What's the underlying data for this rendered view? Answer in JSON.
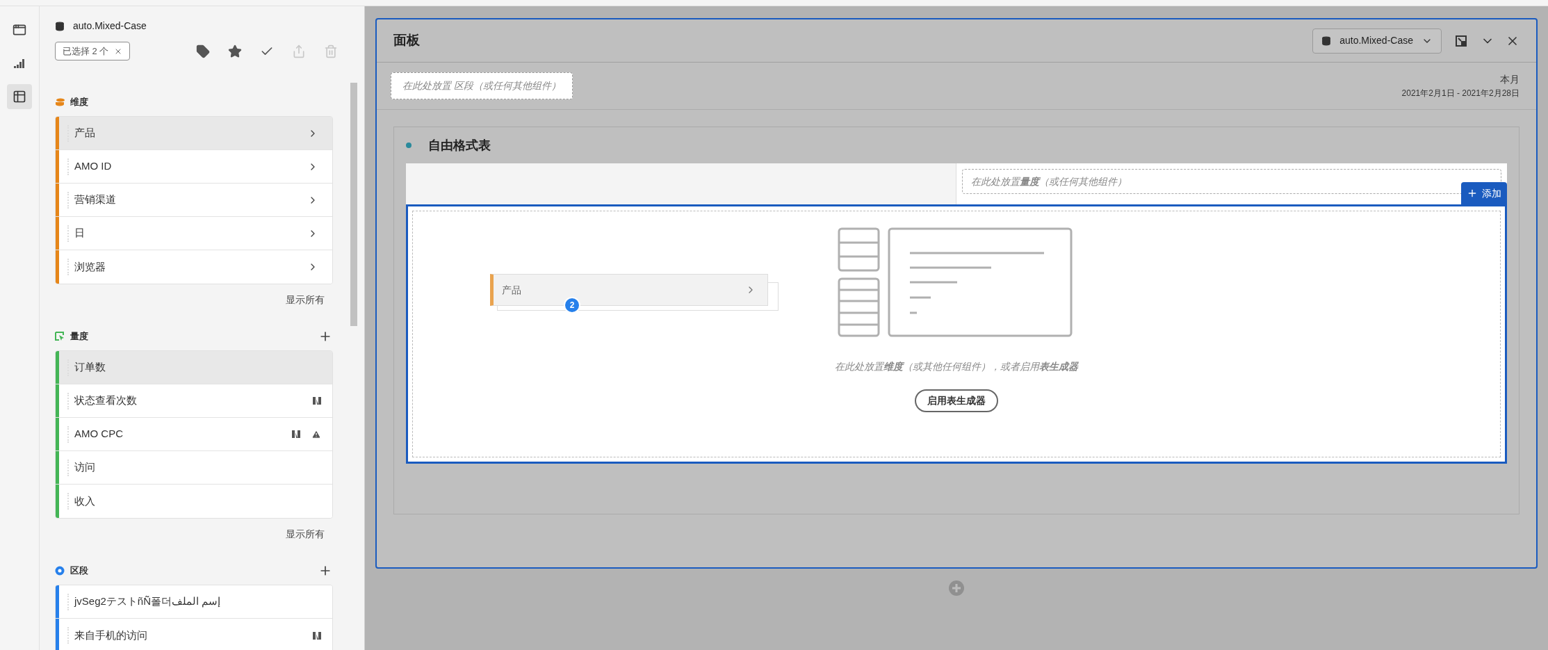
{
  "rail": [
    {
      "kind": "panel",
      "selected": false
    },
    {
      "kind": "chart",
      "selected": false
    },
    {
      "kind": "components",
      "selected": true
    }
  ],
  "sidebar": {
    "suite": "auto.Mixed-Case",
    "selection_chip": "已选择 2 个",
    "toolbar": [
      {
        "kind": "tag",
        "disabled": false
      },
      {
        "kind": "star",
        "disabled": false
      },
      {
        "kind": "check",
        "disabled": false
      },
      {
        "kind": "share",
        "disabled": true
      },
      {
        "kind": "trash",
        "disabled": true
      }
    ],
    "sections": [
      {
        "kind": "dimension",
        "title": "维度",
        "color": "#e68619",
        "show_all": "显示所有",
        "items": [
          {
            "label": "产品",
            "selected": true,
            "adobe": false,
            "warning": false,
            "expandable": true
          },
          {
            "label": "AMO ID",
            "selected": false,
            "adobe": false,
            "warning": false,
            "expandable": true
          },
          {
            "label": "营销渠道",
            "selected": false,
            "adobe": false,
            "warning": false,
            "expandable": true
          },
          {
            "label": "日",
            "selected": false,
            "adobe": false,
            "warning": false,
            "expandable": true
          },
          {
            "label": "浏览器",
            "selected": false,
            "adobe": false,
            "warning": false,
            "expandable": true
          }
        ]
      },
      {
        "kind": "metric",
        "title": "量度",
        "color": "#44b556",
        "add_button": true,
        "show_all": "显示所有",
        "items": [
          {
            "label": "订单数",
            "selected": true,
            "adobe": false,
            "warning": false,
            "expandable": false
          },
          {
            "label": "状态查看次数",
            "selected": false,
            "adobe": true,
            "warning": false,
            "expandable": false
          },
          {
            "label": "AMO CPC",
            "selected": false,
            "adobe": true,
            "warning": true,
            "expandable": false
          },
          {
            "label": "访问",
            "selected": false,
            "adobe": false,
            "warning": false,
            "expandable": false
          },
          {
            "label": "收入",
            "selected": false,
            "adobe": false,
            "warning": false,
            "expandable": false
          }
        ]
      },
      {
        "kind": "segment",
        "title": "区段",
        "color": "#2680eb",
        "add_button": true,
        "items": [
          {
            "label": "jvSeg2テストñÑ폴더إسم الملف",
            "selected": false,
            "adobe": false,
            "warning": false,
            "expandable": false
          },
          {
            "label": "来自手机的访问",
            "selected": false,
            "adobe": true,
            "warning": false,
            "expandable": false
          }
        ]
      }
    ]
  },
  "panel": {
    "title": "面板",
    "suite": "auto.Mixed-Case",
    "segment_drop": "在此处放置 区段（或任何其他组件）",
    "date_label": "本月",
    "date_range": "2021年2月1日 - 2021年2月28日",
    "freeform": {
      "title": "自由格式表",
      "metric_drop": "在此处放置**量度**（或任何其他组件）",
      "add_button": "添加",
      "dragged": {
        "label": "产品",
        "count": "2"
      },
      "hint": "在此处放置**维度**（或其他任何组件），或者启用**表生成器**",
      "builder_button": "启用表生成器"
    }
  }
}
